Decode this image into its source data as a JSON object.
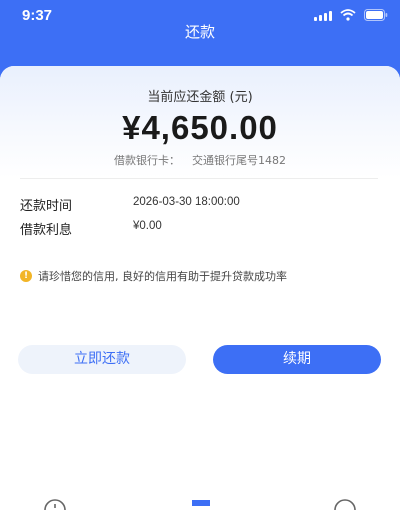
{
  "status_bar": {
    "time": "9:37"
  },
  "header": {
    "title": "还款"
  },
  "summary": {
    "amount_label": "当前应还金额 (元)",
    "amount": "¥4,650.00",
    "bank_label": "借款银行卡：",
    "bank_value": "交通银行尾号1482"
  },
  "details": [
    {
      "label": "还款时间",
      "value": "2026-03-30 18:00:00"
    },
    {
      "label": "借款利息",
      "value": "¥0.00"
    }
  ],
  "tip": {
    "text": "请珍惜您的信用, 良好的信用有助于提升贷款成功率"
  },
  "buttons": {
    "pay_now": "立即还款",
    "extend": "续期"
  },
  "colors": {
    "primary": "#3d6ff5",
    "pay_button_bg": "#eef3fb",
    "tip_icon": "#f2b527"
  },
  "tabbar": {
    "icons": [
      "info-icon",
      "home-icon",
      "user-icon"
    ]
  }
}
